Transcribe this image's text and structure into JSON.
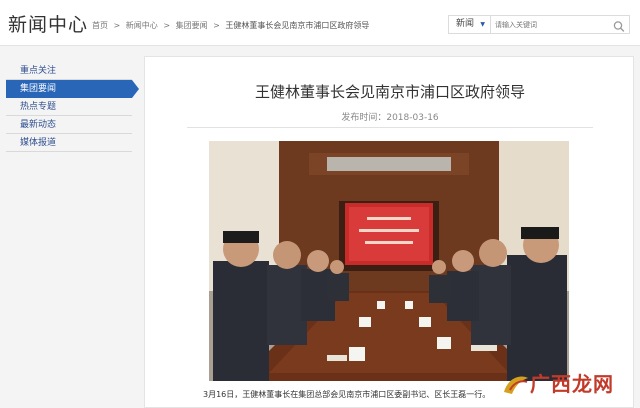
{
  "header": {
    "site_title": "新闻中心",
    "breadcrumb": [
      "首页",
      ">",
      "新闻中心",
      ">",
      "集团要闻",
      ">",
      "王健林董事长会见南京市浦口区政府领导"
    ],
    "search": {
      "scope": "新闻",
      "placeholder": "请输入关键词"
    }
  },
  "sidebar": {
    "items": [
      {
        "label": "重点关注",
        "active": false
      },
      {
        "label": "集团要闻",
        "active": true
      },
      {
        "label": "热点专题",
        "active": false
      },
      {
        "label": "最新动态",
        "active": false
      },
      {
        "label": "媒体报道",
        "active": false
      }
    ]
  },
  "article": {
    "title": "王健林董事长会见南京市浦口区政府领导",
    "publish_label": "发布时间：",
    "publish_date": "2018-03-16",
    "caption": "3月16日，王健林董事长在集团总部会见南京市浦口区委副书记、区长王磊一行。"
  },
  "watermark": {
    "text": "广西龙网"
  },
  "colors": {
    "accent": "#2966b8",
    "link": "#2f4f8f",
    "watermark": "#c23a2a"
  }
}
